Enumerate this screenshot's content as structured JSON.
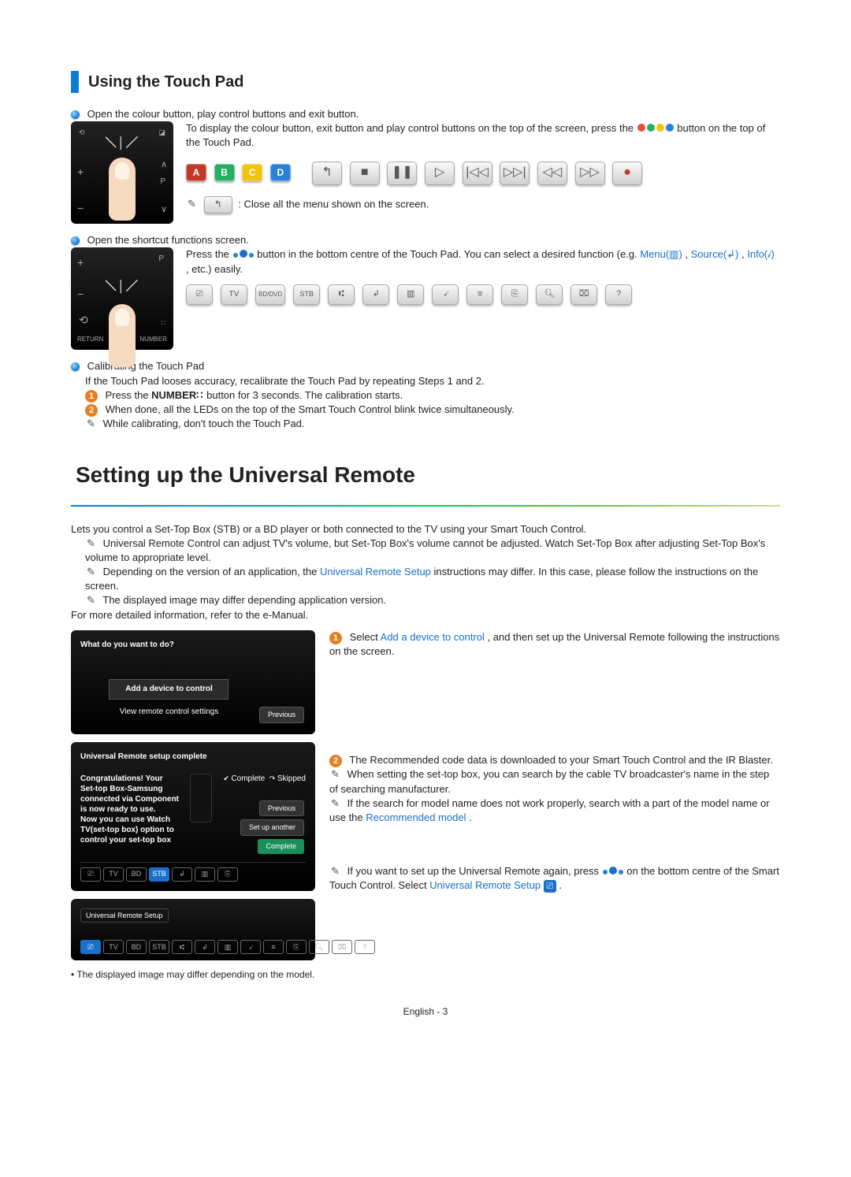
{
  "section1": {
    "heading": "Using the Touch Pad",
    "item1": {
      "title": "Open the colour button, play control buttons and exit button.",
      "desc_a": "To display the colour button, exit button and play control buttons on the top of the screen, press the ",
      "desc_b": " button on the top of the Touch Pad.",
      "keys": {
        "A": "A",
        "B": "B",
        "C": "C",
        "D": "D"
      },
      "note": ": Close all the menu shown on the screen."
    },
    "item2": {
      "title": "Open the shortcut functions screen.",
      "desc_a": "Press the ",
      "desc_b": " button in the bottom centre of the Touch Pad. You can select a desired function (e.g. ",
      "link_menu": "Menu(▥)",
      "link_sep1": ", ",
      "link_source": "Source(↲)",
      "link_sep2": ", ",
      "link_info": "Info(𝒾)",
      "desc_c": ", etc.) easily."
    },
    "item3": {
      "title": "Calibrating the Touch Pad",
      "desc": "If the Touch Pad looses accuracy, recalibrate the Touch Pad by repeating Steps 1 and 2.",
      "step1_a": "Press the ",
      "step1_bold": "NUMBER",
      "step1_b": " button for 3 seconds. The calibration starts.",
      "step2": "When done, all the LEDs on the top of the Smart Touch Control blink twice simultaneously.",
      "note": "While calibrating, don't touch the Touch Pad."
    }
  },
  "section2": {
    "heading": "Setting up the Universal Remote",
    "intro": "Lets you control a Set-Top Box (STB) or a BD player or both connected to the TV using your Smart Touch Control.",
    "note1": "Universal Remote Control can adjust TV's volume, but Set-Top Box's volume cannot be adjusted. Watch Set-Top Box after adjusting Set-Top Box's volume to appropriate level.",
    "note2_a": "Depending on the version of an application, the ",
    "note2_link": "Universal Remote Setup",
    "note2_b": " instructions may differ. In this case, please follow the instructions on the screen.",
    "note3": "The displayed image may differ depending application version.",
    "ref": "For more detailed information, refer to the e-Manual.",
    "ss1": {
      "title": "What do you want to do?",
      "btn1": "Add a device to control",
      "btn2": "View remote control settings",
      "prev": "Previous"
    },
    "step1_a": "Select ",
    "step1_link": "Add a device to control",
    "step1_b": ", and then set up the Universal Remote following the instructions on the screen.",
    "ss2": {
      "title": "Universal Remote setup complete",
      "congrats_lines": [
        "Congratulations! Your",
        "Set-top Box-Samsung",
        "connected via Component",
        "is now ready to use.",
        "Now you can use Watch",
        "TV(set-top box) option to",
        "control your set-top box"
      ],
      "complete": "Complete",
      "skipped": "Skipped",
      "previous": "Previous",
      "setup_another": "Set up another",
      "complete_btn": "Complete"
    },
    "step2": "The Recommended code data is downloaded to your Smart Touch Control and the IR Blaster.",
    "note_a": "When setting the set-top box, you can search by the cable TV broadcaster's name in the step of searching manufacturer.",
    "note_b_a": "If the search for model name does not work properly, search with a part of the model name or use the ",
    "note_b_link": "Recommended model",
    "note_b_b": ".",
    "ss3": {
      "title": "Universal Remote Setup"
    },
    "note_c_a": "If you want to set up the Universal Remote again,  press ",
    "note_c_b": " on the bottom centre of the Smart Touch Control. Select ",
    "note_c_link": "Universal Remote Setup",
    "note_c_c": ".",
    "foot_note": "The displayed image may differ depending on the model."
  },
  "footer": {
    "lang": "English",
    "sep": " - ",
    "page": "3"
  }
}
